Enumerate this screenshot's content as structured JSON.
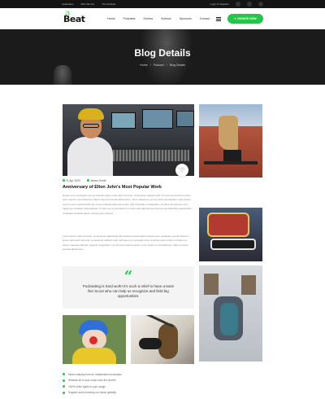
{
  "topbar": {
    "links": [
      "Celebrates",
      "Who We Are",
      "The Podcast"
    ],
    "account": "Login Or Register"
  },
  "header": {
    "logo": "Beat",
    "nav": [
      "Home",
      "Podcasts",
      "Genres",
      "Authors",
      "Sponsors",
      "Contact"
    ],
    "donate": "DONATE NOW"
  },
  "hero": {
    "title": "Blog Details",
    "breadcrumb": [
      "Home",
      "/",
      "Podcast",
      "/",
      "Blog Details"
    ]
  },
  "article": {
    "date": "11 Apr 2020",
    "author": "James Smith",
    "title": "Anniversary of Elton John's Most Popular Work",
    "paragraph_1": "Neque porro quisquam est qui dolorem ipsum quia dolor sit amet, consectetur adipisci velit. Ut enim ad minima veniam, quis nostrum exercitationem ullam corporis suscipit laboriosam, nisi ut aliquid ex ea commodi consequatur. Quis autem vel eum iure reprehenderit qui in ea voluptate velit esse quam nihil molestiae consequatur, vel illum qui dolorem eum fugiat quo voluptas nulla pariatur. At vero eos et accusamus et iusto odio dignissimos ducimus qui blanditiis praesentium voluptatum deleniti atque corrupti quos dolores.",
    "paragraph_2": "Lorem ipsum dolor sit amet, consectetur adipisicing elit. Deserunt aspernatur! Neque porro quisquam est qui dolorem ipsum quia dolor sit amet, consectetur adipisci velit, sed quia non numquam eius modi tempora incidunt ut labore et dolore magnam aliquam quaerat voluptatem. Ut enim ad minima veniam, quis nostrum exercitationem ullam corporis suscipit laboriosam.",
    "quote": "Podcasting is hard work! It's such a relief to have a team like Scoot who can help us recognize and field big opportunities.",
    "checklist": [
      "Music industry from for independent musicians.",
      "Release all of your music onto the world's",
      "100% of the rights to your songs",
      "Support and promoting our music globally."
    ]
  },
  "colors": {
    "accent": "#27c44a",
    "dark": "#141414"
  }
}
